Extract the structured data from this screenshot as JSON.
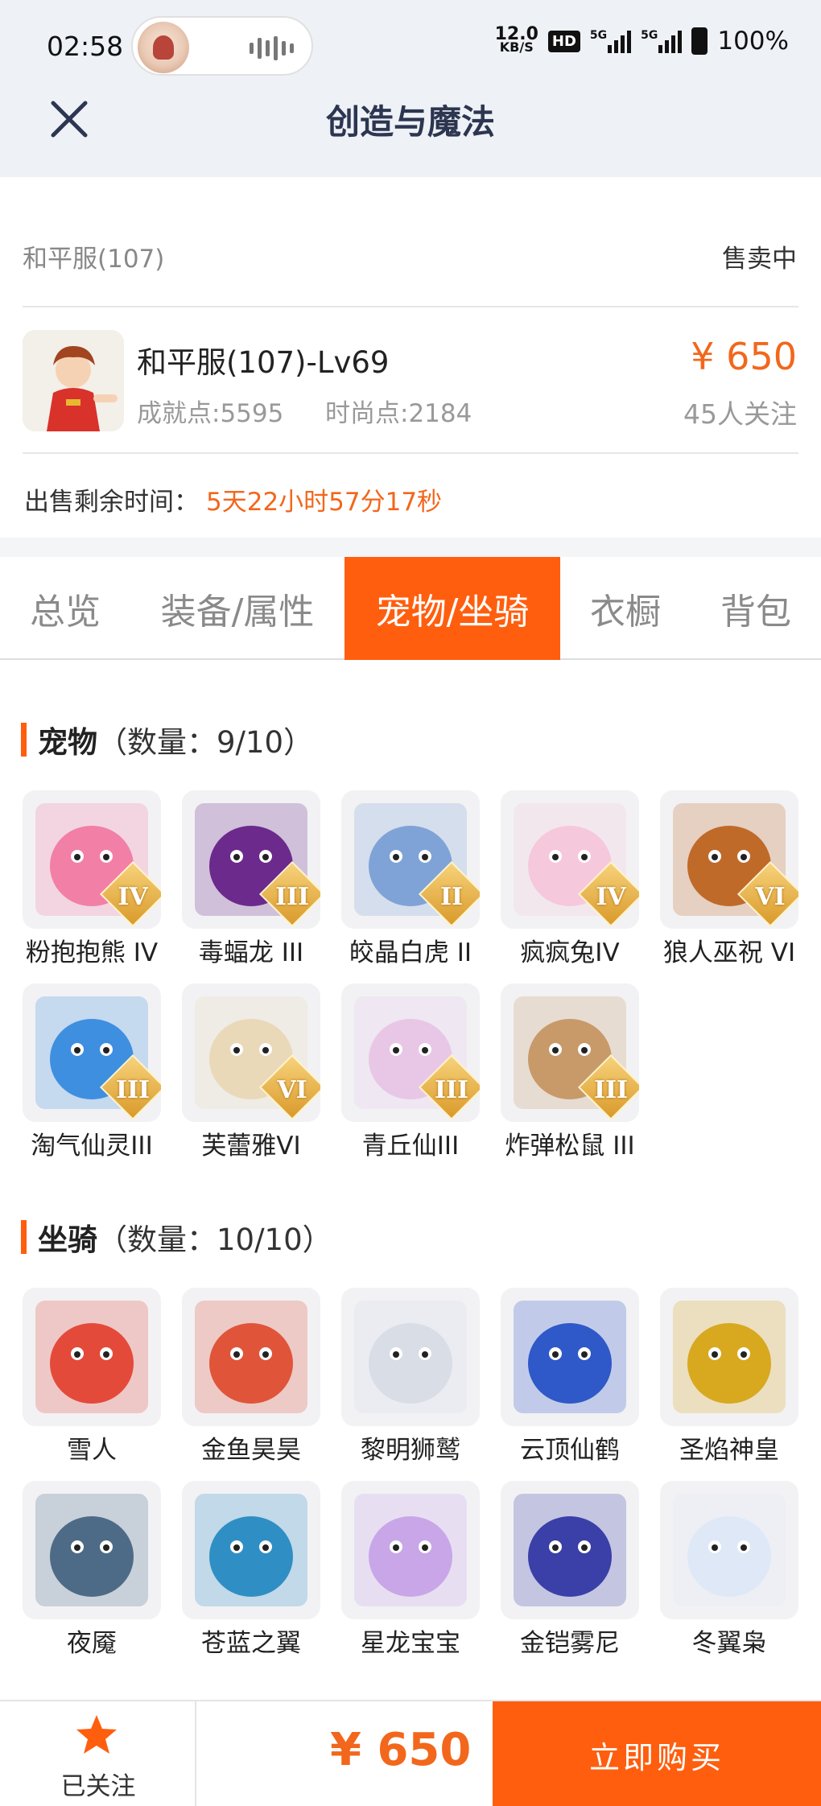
{
  "status_bar": {
    "time": "02:58",
    "net_speed_value": "12.0",
    "net_speed_unit": "KB/S",
    "hd_label": "HD",
    "sim1": "5G",
    "sim2": "5G",
    "battery": "100%"
  },
  "header": {
    "title": "创造与魔法"
  },
  "listing": {
    "server": "和平服(107)",
    "status": "售卖中",
    "title": "和平服(107)-Lv69",
    "achievement": "成就点:5595",
    "fashion": "时尚点:2184",
    "price": "¥ 650",
    "followers": "45人关注",
    "remaining_label": "出售剩余时间：",
    "remaining_value": "5天22小时57分17秒"
  },
  "tabs": [
    "总览",
    "装备/属性",
    "宠物/坐骑",
    "衣橱",
    "背包"
  ],
  "active_tab_index": 2,
  "pets": {
    "title": "宠物",
    "count": "（数量：9/10）",
    "items": [
      {
        "name": "粉抱抱熊 IV",
        "badge": "IV",
        "color": "#f27fa6",
        "icon": "pink-bear-icon"
      },
      {
        "name": "毒蝠龙 III",
        "badge": "III",
        "color": "#6b2a8c",
        "icon": "bat-dragon-icon"
      },
      {
        "name": "皎晶白虎 II",
        "badge": "II",
        "color": "#7fa3d6",
        "icon": "white-tiger-icon"
      },
      {
        "name": "疯疯兔IV",
        "badge": "IV",
        "color": "#f6c8dc",
        "icon": "rabbit-icon"
      },
      {
        "name": "狼人巫祝 VI",
        "badge": "VI",
        "color": "#c06a2a",
        "icon": "werewolf-icon"
      },
      {
        "name": "淘气仙灵III",
        "badge": "III",
        "color": "#3f8fe0",
        "icon": "fairy-pup-icon"
      },
      {
        "name": "芙蕾雅VI",
        "badge": "VI",
        "color": "#e9d9b8",
        "icon": "freya-icon"
      },
      {
        "name": "青丘仙III",
        "badge": "III",
        "color": "#e8c7e6",
        "icon": "fox-fairy-icon"
      },
      {
        "name": "炸弹松鼠 III",
        "badge": "III",
        "color": "#c89a6a",
        "icon": "squirrel-icon"
      }
    ]
  },
  "mounts": {
    "title": "坐骑",
    "count": "（数量：10/10）",
    "items": [
      {
        "name": "雪人",
        "color": "#e44a3a",
        "icon": "snowman-icon"
      },
      {
        "name": "金鱼昊昊",
        "color": "#e0553a",
        "icon": "goldfish-icon"
      },
      {
        "name": "黎明狮鹫",
        "color": "#d8dde6",
        "icon": "griffin-icon"
      },
      {
        "name": "云顶仙鹤",
        "color": "#2f58c8",
        "icon": "crane-icon"
      },
      {
        "name": "圣焰神皇",
        "color": "#d8a81f",
        "icon": "phoenix-icon"
      },
      {
        "name": "夜魇",
        "color": "#4d6b86",
        "icon": "nightmare-horse-icon"
      },
      {
        "name": "苍蓝之翼",
        "color": "#2f8fc4",
        "icon": "azure-wing-icon"
      },
      {
        "name": "星龙宝宝",
        "color": "#c9a6e8",
        "icon": "star-dragon-icon"
      },
      {
        "name": "金铠雾尼",
        "color": "#3b3fa8",
        "icon": "armored-beast-icon"
      },
      {
        "name": "冬翼枭",
        "color": "#dfe8f6",
        "icon": "owl-icon"
      }
    ]
  },
  "bottom_bar": {
    "follow_label": "已关注",
    "price": "¥ 650",
    "buy_label": "立即购买"
  }
}
